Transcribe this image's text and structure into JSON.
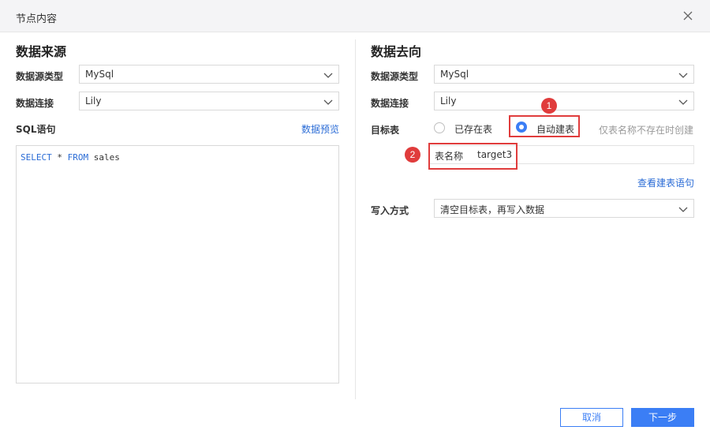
{
  "dialog": {
    "title": "节点内容"
  },
  "source": {
    "section_title": "数据来源",
    "type_label": "数据源类型",
    "type_value": "MySql",
    "conn_label": "数据连接",
    "conn_value": "Lily",
    "sql_label": "SQL语句",
    "preview_link": "数据预览",
    "sql_keyword_select": "SELECT",
    "sql_star": " * ",
    "sql_keyword_from": "FROM",
    "sql_table": " sales"
  },
  "target": {
    "section_title": "数据去向",
    "type_label": "数据源类型",
    "type_value": "MySql",
    "conn_label": "数据连接",
    "conn_value": "Lily",
    "table_label": "目标表",
    "option_existing": "已存在表",
    "option_auto": "自动建表",
    "selected_option": "自动建表",
    "hint": "仅表名称不存在时创建",
    "table_name_label": "表名称",
    "table_name_value": "target3",
    "view_sql_link": "查看建表语句",
    "write_label": "写入方式",
    "write_value": "清空目标表，再写入数据"
  },
  "annotations": {
    "badge_1": "1",
    "badge_2": "2"
  },
  "footer": {
    "cancel": "取消",
    "next": "下一步"
  },
  "colors": {
    "accent": "#3b7ef5",
    "link": "#2b6cd6",
    "annotation": "#e03c3c"
  }
}
